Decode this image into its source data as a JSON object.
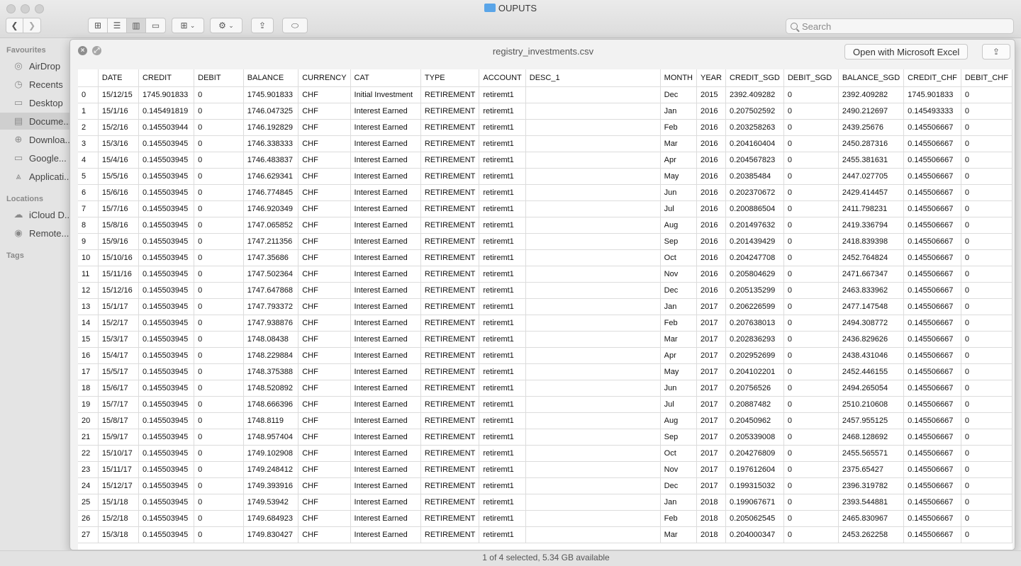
{
  "window": {
    "title": "OUPUTS"
  },
  "toolbar": {
    "view_icons": [
      "icon-view-icon",
      "list-view-icon",
      "column-view-icon",
      "gallery-view-icon"
    ],
    "search_placeholder": "Search"
  },
  "sidebar": {
    "favourites_label": "Favourites",
    "favourites": [
      {
        "label": "AirDrop",
        "icon": "airdrop-icon",
        "glyph": "◎"
      },
      {
        "label": "Recents",
        "icon": "recents-icon",
        "glyph": "◷"
      },
      {
        "label": "Desktop",
        "icon": "desktop-icon",
        "glyph": "▭"
      },
      {
        "label": "Docume...",
        "icon": "documents-icon",
        "glyph": "▤"
      },
      {
        "label": "Downloa...",
        "icon": "downloads-icon",
        "glyph": "⊕"
      },
      {
        "label": "Google...",
        "icon": "folder-icon",
        "glyph": "▭"
      },
      {
        "label": "Applicati...",
        "icon": "applications-icon",
        "glyph": "⩓"
      }
    ],
    "locations_label": "Locations",
    "locations": [
      {
        "label": "iCloud D...",
        "icon": "icloud-icon",
        "glyph": "☁"
      },
      {
        "label": "Remote...",
        "icon": "remote-disc-icon",
        "glyph": "◉"
      }
    ],
    "tags_label": "Tags"
  },
  "quicklook": {
    "filename": "registry_investments.csv",
    "open_button": "Open with Microsoft Excel",
    "columns": [
      "",
      "DATE",
      "CREDIT",
      "DEBIT",
      "BALANCE",
      "CURRENCY",
      "CAT",
      "TYPE",
      "ACCOUNT",
      "DESC_1",
      "MONTH",
      "YEAR",
      "CREDIT_SGD",
      "DEBIT_SGD",
      "BALANCE_SGD",
      "CREDIT_CHF",
      "DEBIT_CHF"
    ],
    "rows": [
      [
        "0",
        "15/12/15",
        "1745.901833",
        "0",
        "1745.901833",
        "CHF",
        "Initial Investment",
        "RETIREMENT",
        "retiremt1",
        "",
        "Dec",
        "2015",
        "2392.409282",
        "0",
        "2392.409282",
        "1745.901833",
        "0"
      ],
      [
        "1",
        "15/1/16",
        "0.145491819",
        "0",
        "1746.047325",
        "CHF",
        "Interest Earned",
        "RETIREMENT",
        "retiremt1",
        "",
        "Jan",
        "2016",
        "0.207502592",
        "0",
        "2490.212697",
        "0.145493333",
        "0"
      ],
      [
        "2",
        "15/2/16",
        "0.145503944",
        "0",
        "1746.192829",
        "CHF",
        "Interest Earned",
        "RETIREMENT",
        "retiremt1",
        "",
        "Feb",
        "2016",
        "0.203258263",
        "0",
        "2439.25676",
        "0.145506667",
        "0"
      ],
      [
        "3",
        "15/3/16",
        "0.145503945",
        "0",
        "1746.338333",
        "CHF",
        "Interest Earned",
        "RETIREMENT",
        "retiremt1",
        "",
        "Mar",
        "2016",
        "0.204160404",
        "0",
        "2450.287316",
        "0.145506667",
        "0"
      ],
      [
        "4",
        "15/4/16",
        "0.145503945",
        "0",
        "1746.483837",
        "CHF",
        "Interest Earned",
        "RETIREMENT",
        "retiremt1",
        "",
        "Apr",
        "2016",
        "0.204567823",
        "0",
        "2455.381631",
        "0.145506667",
        "0"
      ],
      [
        "5",
        "15/5/16",
        "0.145503945",
        "0",
        "1746.629341",
        "CHF",
        "Interest Earned",
        "RETIREMENT",
        "retiremt1",
        "",
        "May",
        "2016",
        "0.20385484",
        "0",
        "2447.027705",
        "0.145506667",
        "0"
      ],
      [
        "6",
        "15/6/16",
        "0.145503945",
        "0",
        "1746.774845",
        "CHF",
        "Interest Earned",
        "RETIREMENT",
        "retiremt1",
        "",
        "Jun",
        "2016",
        "0.202370672",
        "0",
        "2429.414457",
        "0.145506667",
        "0"
      ],
      [
        "7",
        "15/7/16",
        "0.145503945",
        "0",
        "1746.920349",
        "CHF",
        "Interest Earned",
        "RETIREMENT",
        "retiremt1",
        "",
        "Jul",
        "2016",
        "0.200886504",
        "0",
        "2411.798231",
        "0.145506667",
        "0"
      ],
      [
        "8",
        "15/8/16",
        "0.145503945",
        "0",
        "1747.065852",
        "CHF",
        "Interest Earned",
        "RETIREMENT",
        "retiremt1",
        "",
        "Aug",
        "2016",
        "0.201497632",
        "0",
        "2419.336794",
        "0.145506667",
        "0"
      ],
      [
        "9",
        "15/9/16",
        "0.145503945",
        "0",
        "1747.211356",
        "CHF",
        "Interest Earned",
        "RETIREMENT",
        "retiremt1",
        "",
        "Sep",
        "2016",
        "0.201439429",
        "0",
        "2418.839398",
        "0.145506667",
        "0"
      ],
      [
        "10",
        "15/10/16",
        "0.145503945",
        "0",
        "1747.35686",
        "CHF",
        "Interest Earned",
        "RETIREMENT",
        "retiremt1",
        "",
        "Oct",
        "2016",
        "0.204247708",
        "0",
        "2452.764824",
        "0.145506667",
        "0"
      ],
      [
        "11",
        "15/11/16",
        "0.145503945",
        "0",
        "1747.502364",
        "CHF",
        "Interest Earned",
        "RETIREMENT",
        "retiremt1",
        "",
        "Nov",
        "2016",
        "0.205804629",
        "0",
        "2471.667347",
        "0.145506667",
        "0"
      ],
      [
        "12",
        "15/12/16",
        "0.145503945",
        "0",
        "1747.647868",
        "CHF",
        "Interest Earned",
        "RETIREMENT",
        "retiremt1",
        "",
        "Dec",
        "2016",
        "0.205135299",
        "0",
        "2463.833962",
        "0.145506667",
        "0"
      ],
      [
        "13",
        "15/1/17",
        "0.145503945",
        "0",
        "1747.793372",
        "CHF",
        "Interest Earned",
        "RETIREMENT",
        "retiremt1",
        "",
        "Jan",
        "2017",
        "0.206226599",
        "0",
        "2477.147548",
        "0.145506667",
        "0"
      ],
      [
        "14",
        "15/2/17",
        "0.145503945",
        "0",
        "1747.938876",
        "CHF",
        "Interest Earned",
        "RETIREMENT",
        "retiremt1",
        "",
        "Feb",
        "2017",
        "0.207638013",
        "0",
        "2494.308772",
        "0.145506667",
        "0"
      ],
      [
        "15",
        "15/3/17",
        "0.145503945",
        "0",
        "1748.08438",
        "CHF",
        "Interest Earned",
        "RETIREMENT",
        "retiremt1",
        "",
        "Mar",
        "2017",
        "0.202836293",
        "0",
        "2436.829626",
        "0.145506667",
        "0"
      ],
      [
        "16",
        "15/4/17",
        "0.145503945",
        "0",
        "1748.229884",
        "CHF",
        "Interest Earned",
        "RETIREMENT",
        "retiremt1",
        "",
        "Apr",
        "2017",
        "0.202952699",
        "0",
        "2438.431046",
        "0.145506667",
        "0"
      ],
      [
        "17",
        "15/5/17",
        "0.145503945",
        "0",
        "1748.375388",
        "CHF",
        "Interest Earned",
        "RETIREMENT",
        "retiremt1",
        "",
        "May",
        "2017",
        "0.204102201",
        "0",
        "2452.446155",
        "0.145506667",
        "0"
      ],
      [
        "18",
        "15/6/17",
        "0.145503945",
        "0",
        "1748.520892",
        "CHF",
        "Interest Earned",
        "RETIREMENT",
        "retiremt1",
        "",
        "Jun",
        "2017",
        "0.20756526",
        "0",
        "2494.265054",
        "0.145506667",
        "0"
      ],
      [
        "19",
        "15/7/17",
        "0.145503945",
        "0",
        "1748.666396",
        "CHF",
        "Interest Earned",
        "RETIREMENT",
        "retiremt1",
        "",
        "Jul",
        "2017",
        "0.20887482",
        "0",
        "2510.210608",
        "0.145506667",
        "0"
      ],
      [
        "20",
        "15/8/17",
        "0.145503945",
        "0",
        "1748.8119",
        "CHF",
        "Interest Earned",
        "RETIREMENT",
        "retiremt1",
        "",
        "Aug",
        "2017",
        "0.20450962",
        "0",
        "2457.955125",
        "0.145506667",
        "0"
      ],
      [
        "21",
        "15/9/17",
        "0.145503945",
        "0",
        "1748.957404",
        "CHF",
        "Interest Earned",
        "RETIREMENT",
        "retiremt1",
        "",
        "Sep",
        "2017",
        "0.205339008",
        "0",
        "2468.128692",
        "0.145506667",
        "0"
      ],
      [
        "22",
        "15/10/17",
        "0.145503945",
        "0",
        "1749.102908",
        "CHF",
        "Interest Earned",
        "RETIREMENT",
        "retiremt1",
        "",
        "Oct",
        "2017",
        "0.204276809",
        "0",
        "2455.565571",
        "0.145506667",
        "0"
      ],
      [
        "23",
        "15/11/17",
        "0.145503945",
        "0",
        "1749.248412",
        "CHF",
        "Interest Earned",
        "RETIREMENT",
        "retiremt1",
        "",
        "Nov",
        "2017",
        "0.197612604",
        "0",
        "2375.65427",
        "0.145506667",
        "0"
      ],
      [
        "24",
        "15/12/17",
        "0.145503945",
        "0",
        "1749.393916",
        "CHF",
        "Interest Earned",
        "RETIREMENT",
        "retiremt1",
        "",
        "Dec",
        "2017",
        "0.199315032",
        "0",
        "2396.319782",
        "0.145506667",
        "0"
      ],
      [
        "25",
        "15/1/18",
        "0.145503945",
        "0",
        "1749.53942",
        "CHF",
        "Interest Earned",
        "RETIREMENT",
        "retiremt1",
        "",
        "Jan",
        "2018",
        "0.199067671",
        "0",
        "2393.544881",
        "0.145506667",
        "0"
      ],
      [
        "26",
        "15/2/18",
        "0.145503945",
        "0",
        "1749.684923",
        "CHF",
        "Interest Earned",
        "RETIREMENT",
        "retiremt1",
        "",
        "Feb",
        "2018",
        "0.205062545",
        "0",
        "2465.830967",
        "0.145506667",
        "0"
      ],
      [
        "27",
        "15/3/18",
        "0.145503945",
        "0",
        "1749.830427",
        "CHF",
        "Interest Earned",
        "RETIREMENT",
        "retiremt1",
        "",
        "Mar",
        "2018",
        "0.204000347",
        "0",
        "2453.262258",
        "0.145506667",
        "0"
      ]
    ]
  },
  "status": {
    "text": "1 of 4 selected, 5.34 GB available"
  }
}
